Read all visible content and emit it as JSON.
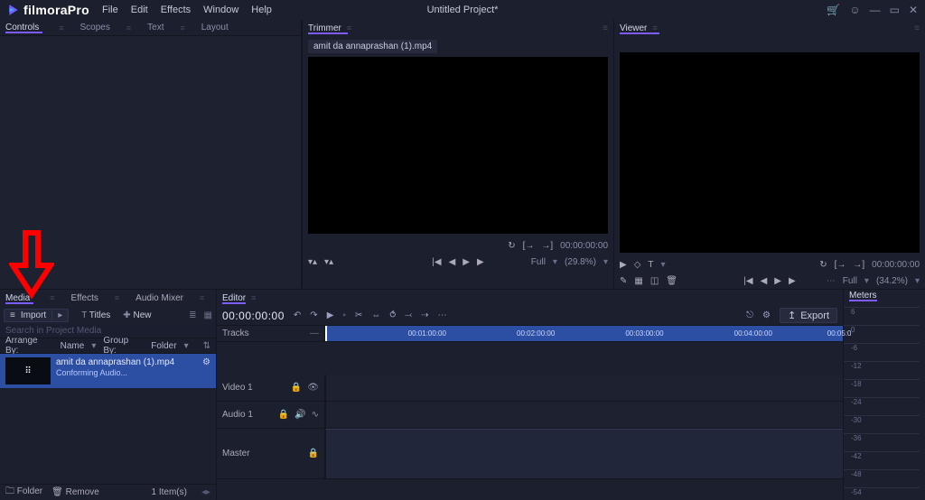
{
  "app": {
    "name": "filmoraPro",
    "title": "Untitled Project*"
  },
  "menu": [
    "File",
    "Edit",
    "Effects",
    "Window",
    "Help"
  ],
  "titlebar_icons": [
    "cart-icon",
    "user-icon",
    "minimize-icon",
    "maximize-icon",
    "close-icon"
  ],
  "topLeftTabs": [
    "Controls",
    "Scopes",
    "Text",
    "Layout"
  ],
  "trimmer": {
    "tab": "Trimmer",
    "clip": "amit da annaprashan (1).mp4",
    "timecode": "00:00:00:00",
    "scale_label": "Full",
    "scale_pct": "(29.8%)"
  },
  "viewer": {
    "tab": "Viewer",
    "timecode": "00:00:00:00",
    "scale_label": "Full",
    "scale_pct": "(34.2%)"
  },
  "mediaTabs": [
    "Media",
    "Effects",
    "Audio Mixer"
  ],
  "mediaToolbar": {
    "import": "Import",
    "titles": "Titles",
    "new": "New"
  },
  "mediaSearchPlaceholder": "Search in Project Media",
  "arrange": {
    "label": "Arrange By:",
    "value": "Name",
    "group_label": "Group By:",
    "group_value": "Folder"
  },
  "clip": {
    "name": "amit da annaprashan (1).mp4",
    "status": "Conforming Audio..."
  },
  "mediaFooter": {
    "folder": "Folder",
    "remove": "Remove",
    "count": "1 Item(s)"
  },
  "editor": {
    "tab": "Editor",
    "timecode": "00:00:00:00",
    "export": "Export",
    "tracksLabel": "Tracks",
    "rulerTicks": [
      "00:01:00:00",
      "00:02:00:00",
      "00:03:00:00",
      "00:04:00:00",
      "00:05:0"
    ],
    "trackNames": [
      "Video 1",
      "Audio 1",
      "Master"
    ]
  },
  "meters": {
    "tab": "Meters",
    "ticks": [
      "6",
      "0",
      "-6",
      "-12",
      "-18",
      "-24",
      "-30",
      "-36",
      "-42",
      "-48",
      "-54"
    ]
  }
}
